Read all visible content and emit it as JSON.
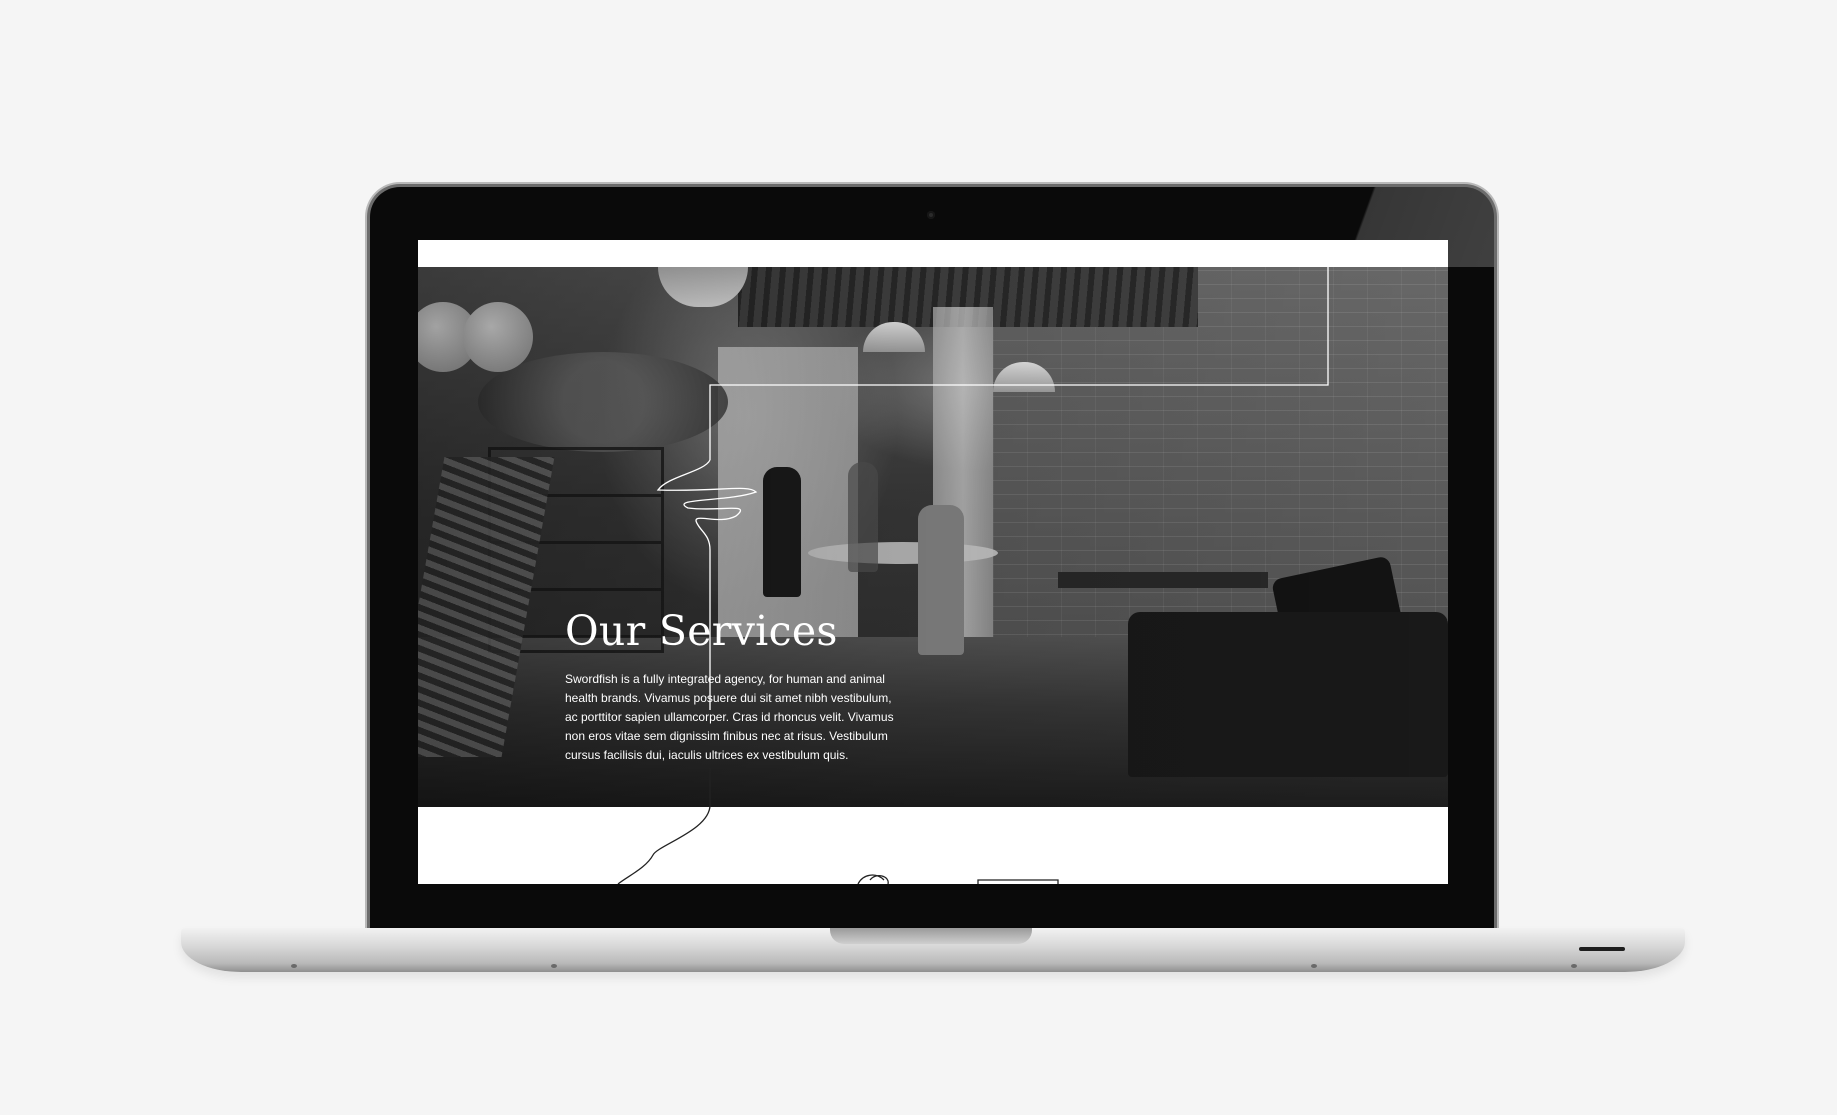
{
  "page": {
    "title": "Our Services",
    "body": "Swordfish is a fully integrated agency, for human and animal health brands. Vivamus posuere dui sit amet nibh vestibulum, ac porttitor sapien ullamcorper. Cras id rhoncus velit. Vivamus non eros vitae sem dignissim finibus nec at risus. Vestibulum cursus facilisis dui, iaculis ultrices ex vestibulum quis."
  },
  "device": {
    "type": "laptop-mockup",
    "color": "#c8c8c8",
    "bezel_color": "#0a0a0a"
  },
  "hero": {
    "image": "office-interior-photo",
    "tone": "black-and-white"
  },
  "colors": {
    "background": "#f5f5f5",
    "text": "#ffffff",
    "line_art": "#ffffff"
  }
}
